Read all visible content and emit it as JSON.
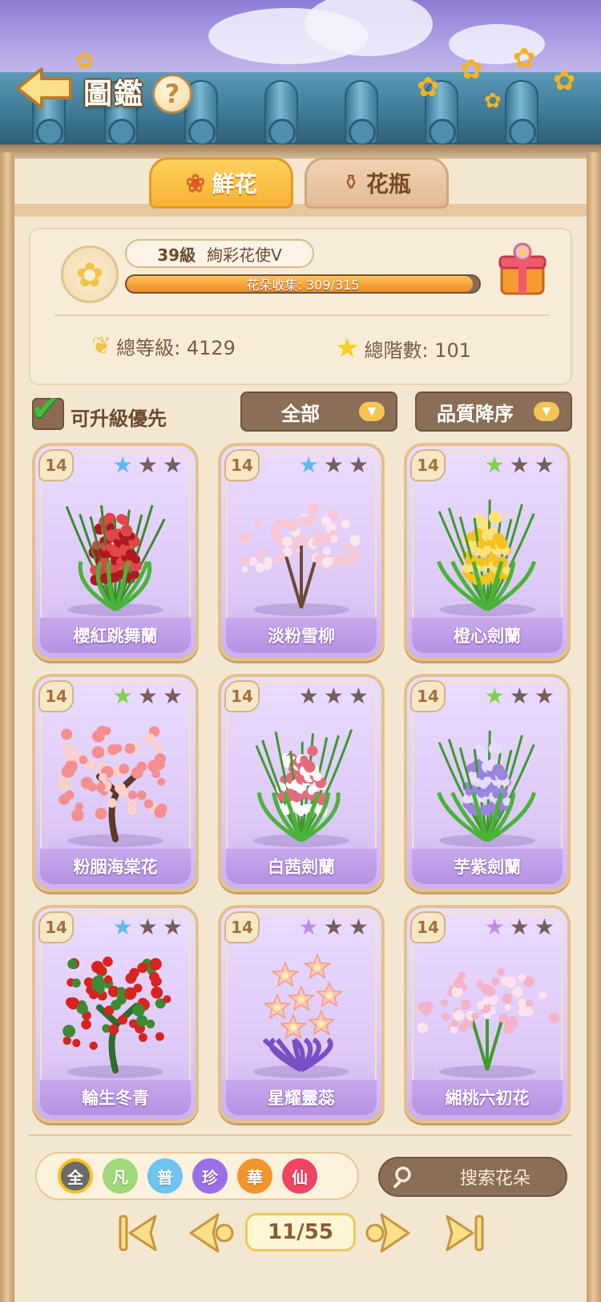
{
  "header": {
    "title": "圖鑑",
    "help_label": "?"
  },
  "tabs": [
    {
      "label": "鮮花",
      "active": true
    },
    {
      "label": "花瓶",
      "active": false
    }
  ],
  "summary": {
    "level": "39級",
    "rank_title": "絢彩花使V",
    "collection_label": "花朵收集: 309/315",
    "collection_progress": 0.981,
    "total_level_label": "總等級: 4129",
    "total_stars_label": "總階數: 101"
  },
  "filters": {
    "upgradable_first_label": "可升級優先",
    "upgradable_first_checked": true,
    "category": "全部",
    "sort": "品質降序"
  },
  "cards": [
    {
      "name": "櫻紅跳舞蘭",
      "level": "14",
      "star_color": "#5cb8f0",
      "stars_filled": 1,
      "art": "red-orchid"
    },
    {
      "name": "淡粉雪柳",
      "level": "14",
      "star_color": "#5cb8f0",
      "stars_filled": 1,
      "art": "pink-willow"
    },
    {
      "name": "橙心劍蘭",
      "level": "14",
      "star_color": "#7fd24a",
      "stars_filled": 1,
      "art": "yellow-gladiolus"
    },
    {
      "name": "粉胭海棠花",
      "level": "14",
      "star_color": "#7fd24a",
      "stars_filled": 1,
      "art": "pink-crabapple"
    },
    {
      "name": "白茜劍蘭",
      "level": "14",
      "star_color": "#7a5c5c",
      "stars_filled": 0,
      "art": "white-gladiolus"
    },
    {
      "name": "芋紫劍蘭",
      "level": "14",
      "star_color": "#7fd24a",
      "stars_filled": 1,
      "art": "purple-gladiolus"
    },
    {
      "name": "輪生冬青",
      "level": "14",
      "star_color": "#5cb8f0",
      "stars_filled": 1,
      "art": "holly"
    },
    {
      "name": "星耀靈蕊",
      "level": "14",
      "star_color": "#c08ce8",
      "stars_filled": 1,
      "art": "star-flower"
    },
    {
      "name": "緗桃六初花",
      "level": "14",
      "star_color": "#c08ce8",
      "stars_filled": 1,
      "art": "pink-freesia"
    }
  ],
  "rarity_filters": [
    {
      "label": "全",
      "color": "#6b6b6b",
      "selected": true
    },
    {
      "label": "凡",
      "color": "#9fd878",
      "selected": false
    },
    {
      "label": "普",
      "color": "#6ec3ef",
      "selected": false
    },
    {
      "label": "珍",
      "color": "#9b6ee8",
      "selected": false
    },
    {
      "label": "華",
      "color": "#f0962c",
      "selected": false
    },
    {
      "label": "仙",
      "color": "#ef4463",
      "selected": false
    }
  ],
  "search": {
    "placeholder": "搜索花朵"
  },
  "pagination": {
    "label": "11/55",
    "current": 11,
    "total": 55
  }
}
